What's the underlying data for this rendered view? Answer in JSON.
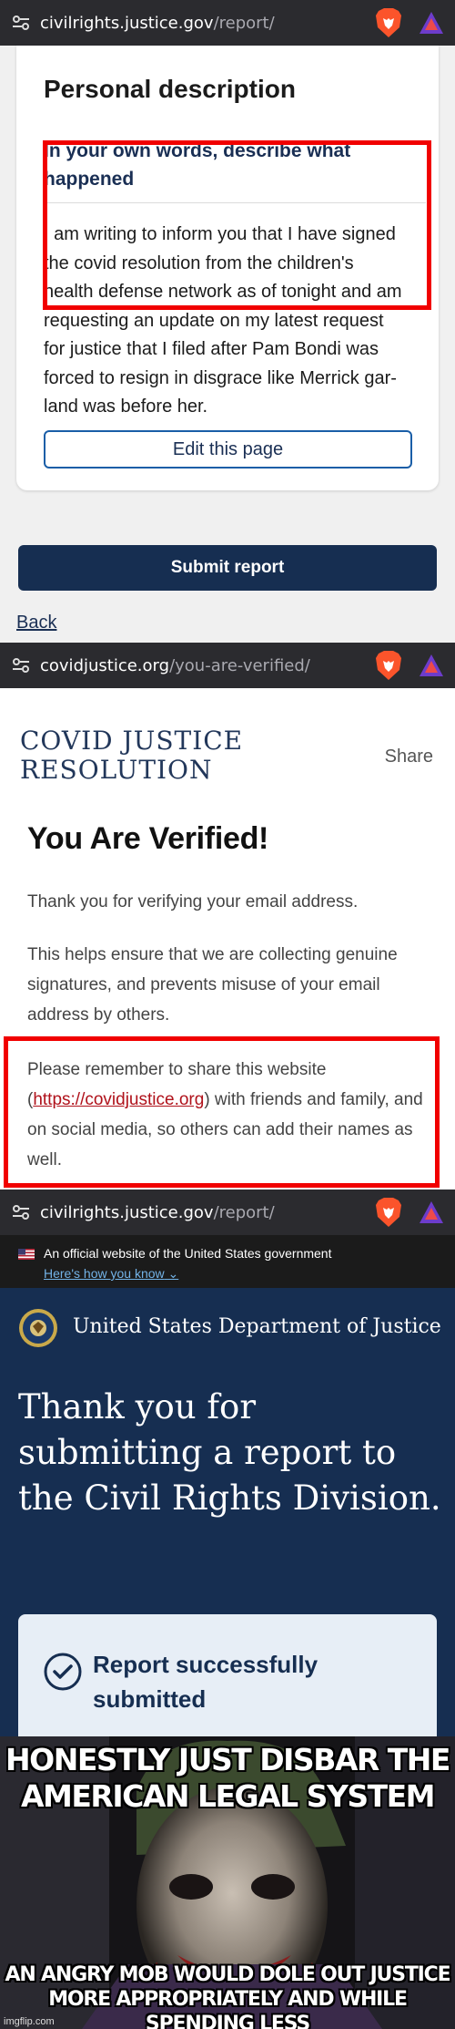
{
  "shot1": {
    "url": {
      "domain": "civilrights.justice.gov",
      "path": "/report/"
    },
    "heading": "Personal description",
    "question_label": "In your own words, describe what happened",
    "answer_lines": [
      "I am writing to inform you that I have signed",
      "the covid resolution from the children's",
      "health defense network as of tonight and am",
      "requesting an update on my latest request",
      "for justice that I filed after Pam Bondi was",
      "forced to resign in disgrace like Merrick gar-",
      "land was before her."
    ],
    "edit_button": "Edit this page",
    "submit_button": "Submit report",
    "back_link": "Back"
  },
  "shot2": {
    "url": {
      "domain": "covidjustice.org",
      "path": "/you-are-verified/"
    },
    "logo_line1": "COVID JUSTICE",
    "logo_line2": "RESOLUTION",
    "share": "Share",
    "heading": "You Are Verified!",
    "para1": "Thank you for verifying your email address.",
    "para2": "This helps ensure that we are collecting genuine signatures, and prevents misuse of your email address by others.",
    "para3_before": "Please remember to share this website (",
    "para3_link": "https://covidjustice.org",
    "para3_after": ") with friends and family, and on social media, so others can add their names as well."
  },
  "shot3": {
    "url": {
      "domain": "civilrights.justice.gov",
      "path": "/report/"
    },
    "gov_banner": "An official website of the United States government",
    "how_link": "Here's how you know",
    "agency": "United States Department of Justice",
    "thanks_heading": "Thank you for submitting a report to the Civil Rights Division.",
    "alert_text": "Report successfully submitted"
  },
  "meme": {
    "top_text": "HONESTLY JUST DISBAR THE AMERICAN LEGAL SYSTEM",
    "bottom_text": "AN ANGRY MOB WOULD DOLE OUT JUSTICE MORE APPROPRIATELY AND WHILE SPENDING LESS",
    "watermark": "imgflip.com"
  },
  "colors": {
    "highlight_red": "#f10000",
    "doj_navy": "#162e51",
    "browser_bar": "#2b2b2f"
  },
  "icons": [
    "lock-icon",
    "brave-lion-icon",
    "vpn-triangle-icon",
    "us-flag-icon",
    "doj-seal-icon",
    "check-circle-icon",
    "chevron-down-icon"
  ]
}
